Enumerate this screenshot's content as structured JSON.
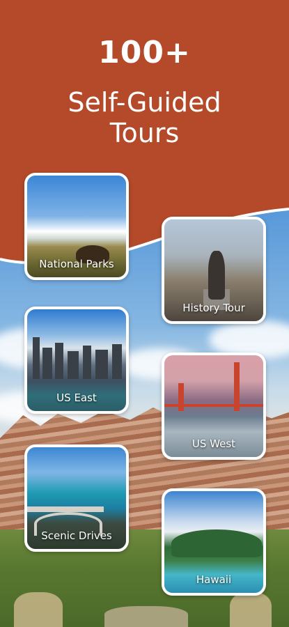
{
  "header": {
    "count": "100+",
    "title_line1": "Self-Guided",
    "title_line2": "Tours",
    "bg_color": "#b44a2a"
  },
  "cards": {
    "national_parks": {
      "label": "National Parks"
    },
    "history_tour": {
      "label": "History Tour"
    },
    "us_east": {
      "label": "US East"
    },
    "us_west": {
      "label": "US West"
    },
    "scenic_drives": {
      "label": "Scenic Drives"
    },
    "hawaii": {
      "label": "Hawaii"
    }
  }
}
